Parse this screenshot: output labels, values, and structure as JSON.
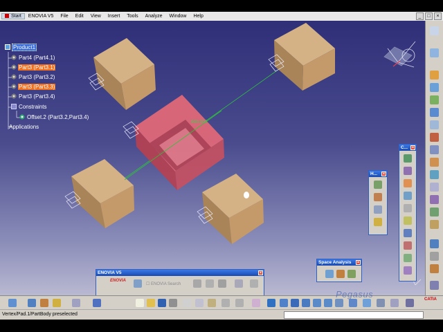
{
  "menu": {
    "items": [
      "Start",
      "ENOVIA V5",
      "File",
      "Edit",
      "View",
      "Insert",
      "Tools",
      "Analyze",
      "Window",
      "Help"
    ]
  },
  "tree": {
    "root": "Product1",
    "parts": [
      "Part4 (Part4.1)",
      "Part3 (Part3.1)",
      "Part3 (Part3.2)",
      "Part3 (Part3.3)",
      "Part3 (Part3.4)"
    ],
    "constraints": "Constraints",
    "offset": "Offset.2 (Part3.2,Part3.4)",
    "applications": "Applications"
  },
  "dimension_label": "900.000",
  "toolbars": {
    "enovia_title": "ENOVIA V5",
    "enovia_check": "ENOVIA Search",
    "enovia_logo": "ENOVIA",
    "h_title": "H...",
    "c_title": "C...",
    "space_title": "Space Analysis"
  },
  "watermark": "Pegasus",
  "status": {
    "message": "Vertex/Pad.1/PartBody preselected"
  },
  "logo_text": "CATIA",
  "colors": {
    "background_top": "#2f2f78",
    "background_bottom": "#b9b9d2",
    "cube_face": "#c8a070",
    "highlight_orange": "#f07020",
    "selected_blue": "#3a6cd8",
    "pink_part": "#e05a6a"
  }
}
